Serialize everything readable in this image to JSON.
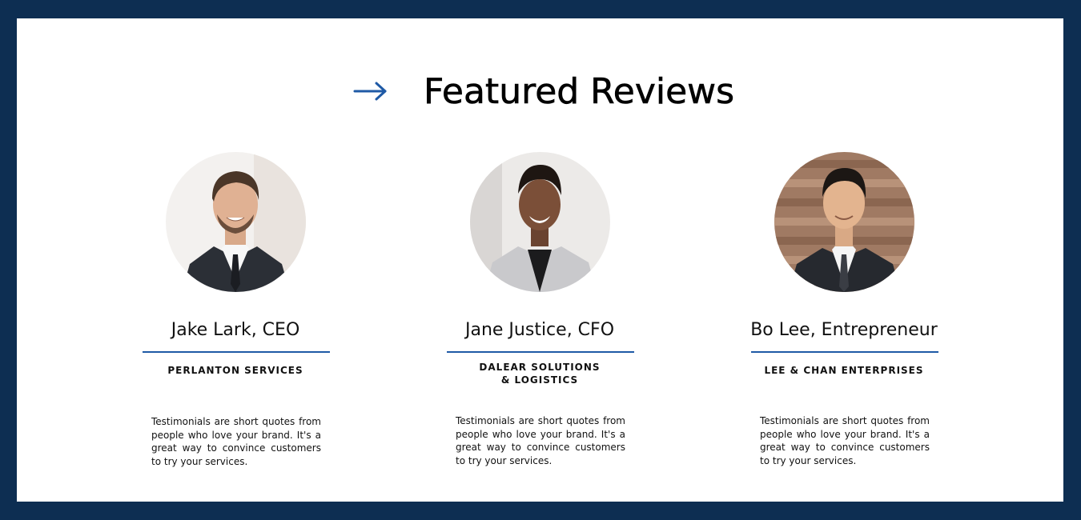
{
  "heading": {
    "title": "Featured Reviews",
    "icon": "arrow-right-icon"
  },
  "colors": {
    "border": "#0d2e52",
    "background": "#ffffff",
    "accent": "#1f5aa6",
    "text": "#111111"
  },
  "reviews": [
    {
      "name": "Jake Lark, CEO",
      "company": "PERLANTON SERVICES",
      "quote": "Testimonials are short quotes from people who love your brand. It's a great way to convince customers to try your services.",
      "avatar": "portrait-photo"
    },
    {
      "name": "Jane Justice, CFO",
      "company": "DALEAR SOLUTIONS\n& LOGISTICS",
      "quote": "Testimonials are short quotes from people who love your brand. It's a great way to convince customers to try your services.",
      "avatar": "portrait-photo"
    },
    {
      "name": "Bo Lee, Entrepreneur",
      "company": "LEE & CHAN ENTERPRISES",
      "quote": "Testimonials are short quotes from people who love your brand. It's a great way to convince customers to try your services.",
      "avatar": "portrait-photo"
    }
  ]
}
